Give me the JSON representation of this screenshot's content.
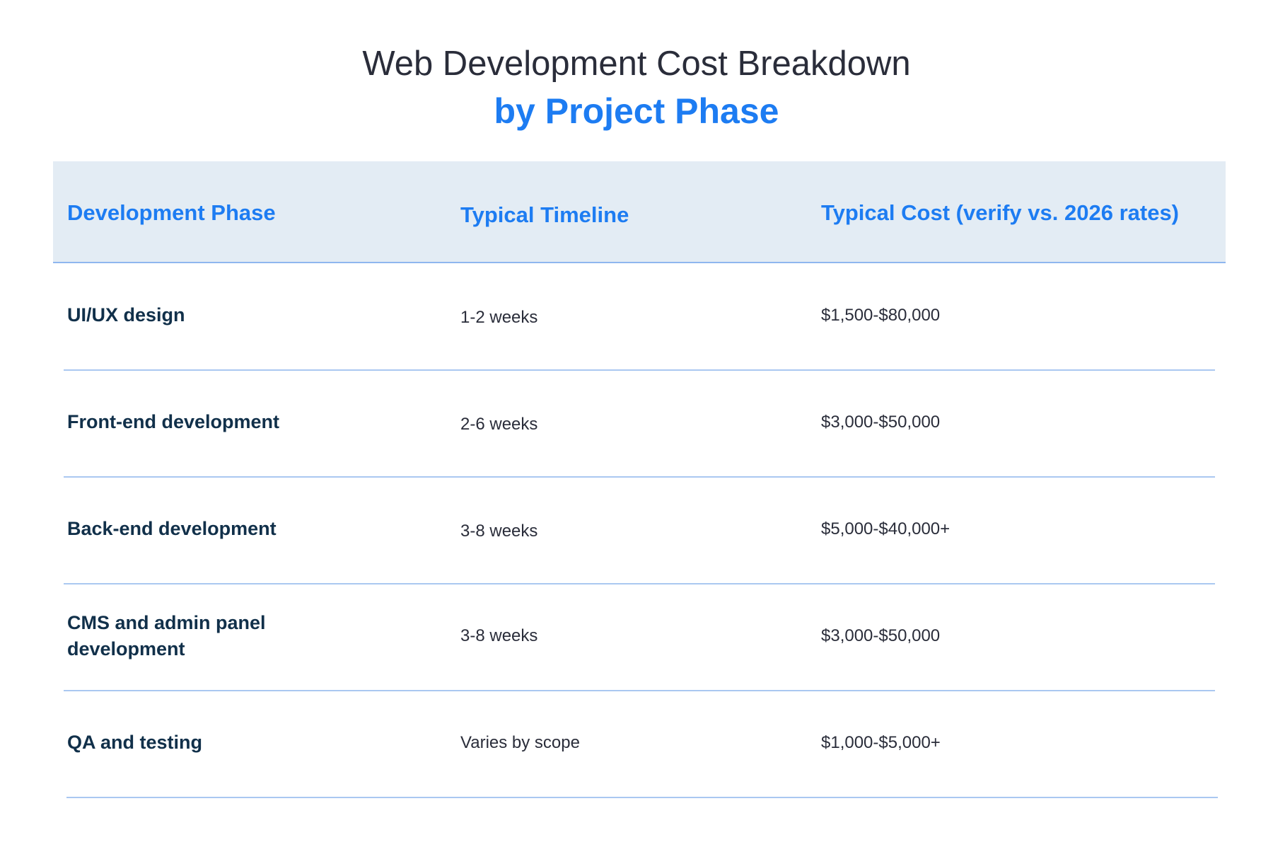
{
  "title": {
    "line1": "Web Development Cost Breakdown",
    "line2": "by Project Phase"
  },
  "table": {
    "headers": [
      "Development Phase",
      "Typical Timeline",
      "Typical Cost (verify vs. 2026 rates)"
    ],
    "rows": [
      {
        "phase": "UI/UX design",
        "timeline": "1-2 weeks",
        "cost": "$1,500-$80,000"
      },
      {
        "phase": "Front-end development",
        "timeline": "2-6 weeks",
        "cost": "$3,000-$50,000"
      },
      {
        "phase": "Back-end development",
        "timeline": "3-8 weeks",
        "cost": "$5,000-$40,000+"
      },
      {
        "phase": "CMS and admin panel development",
        "timeline": "3-8 weeks",
        "cost": "$3,000-$50,000"
      },
      {
        "phase": "QA and testing",
        "timeline": "Varies by scope",
        "cost": "$1,000-$5,000+"
      }
    ]
  },
  "colors": {
    "title_dark": "#2a2d3a",
    "accent_blue": "#1d7cf2",
    "header_bg": "#e3ecf4",
    "row_text": "#11304a",
    "divider": "#aac8f1"
  }
}
